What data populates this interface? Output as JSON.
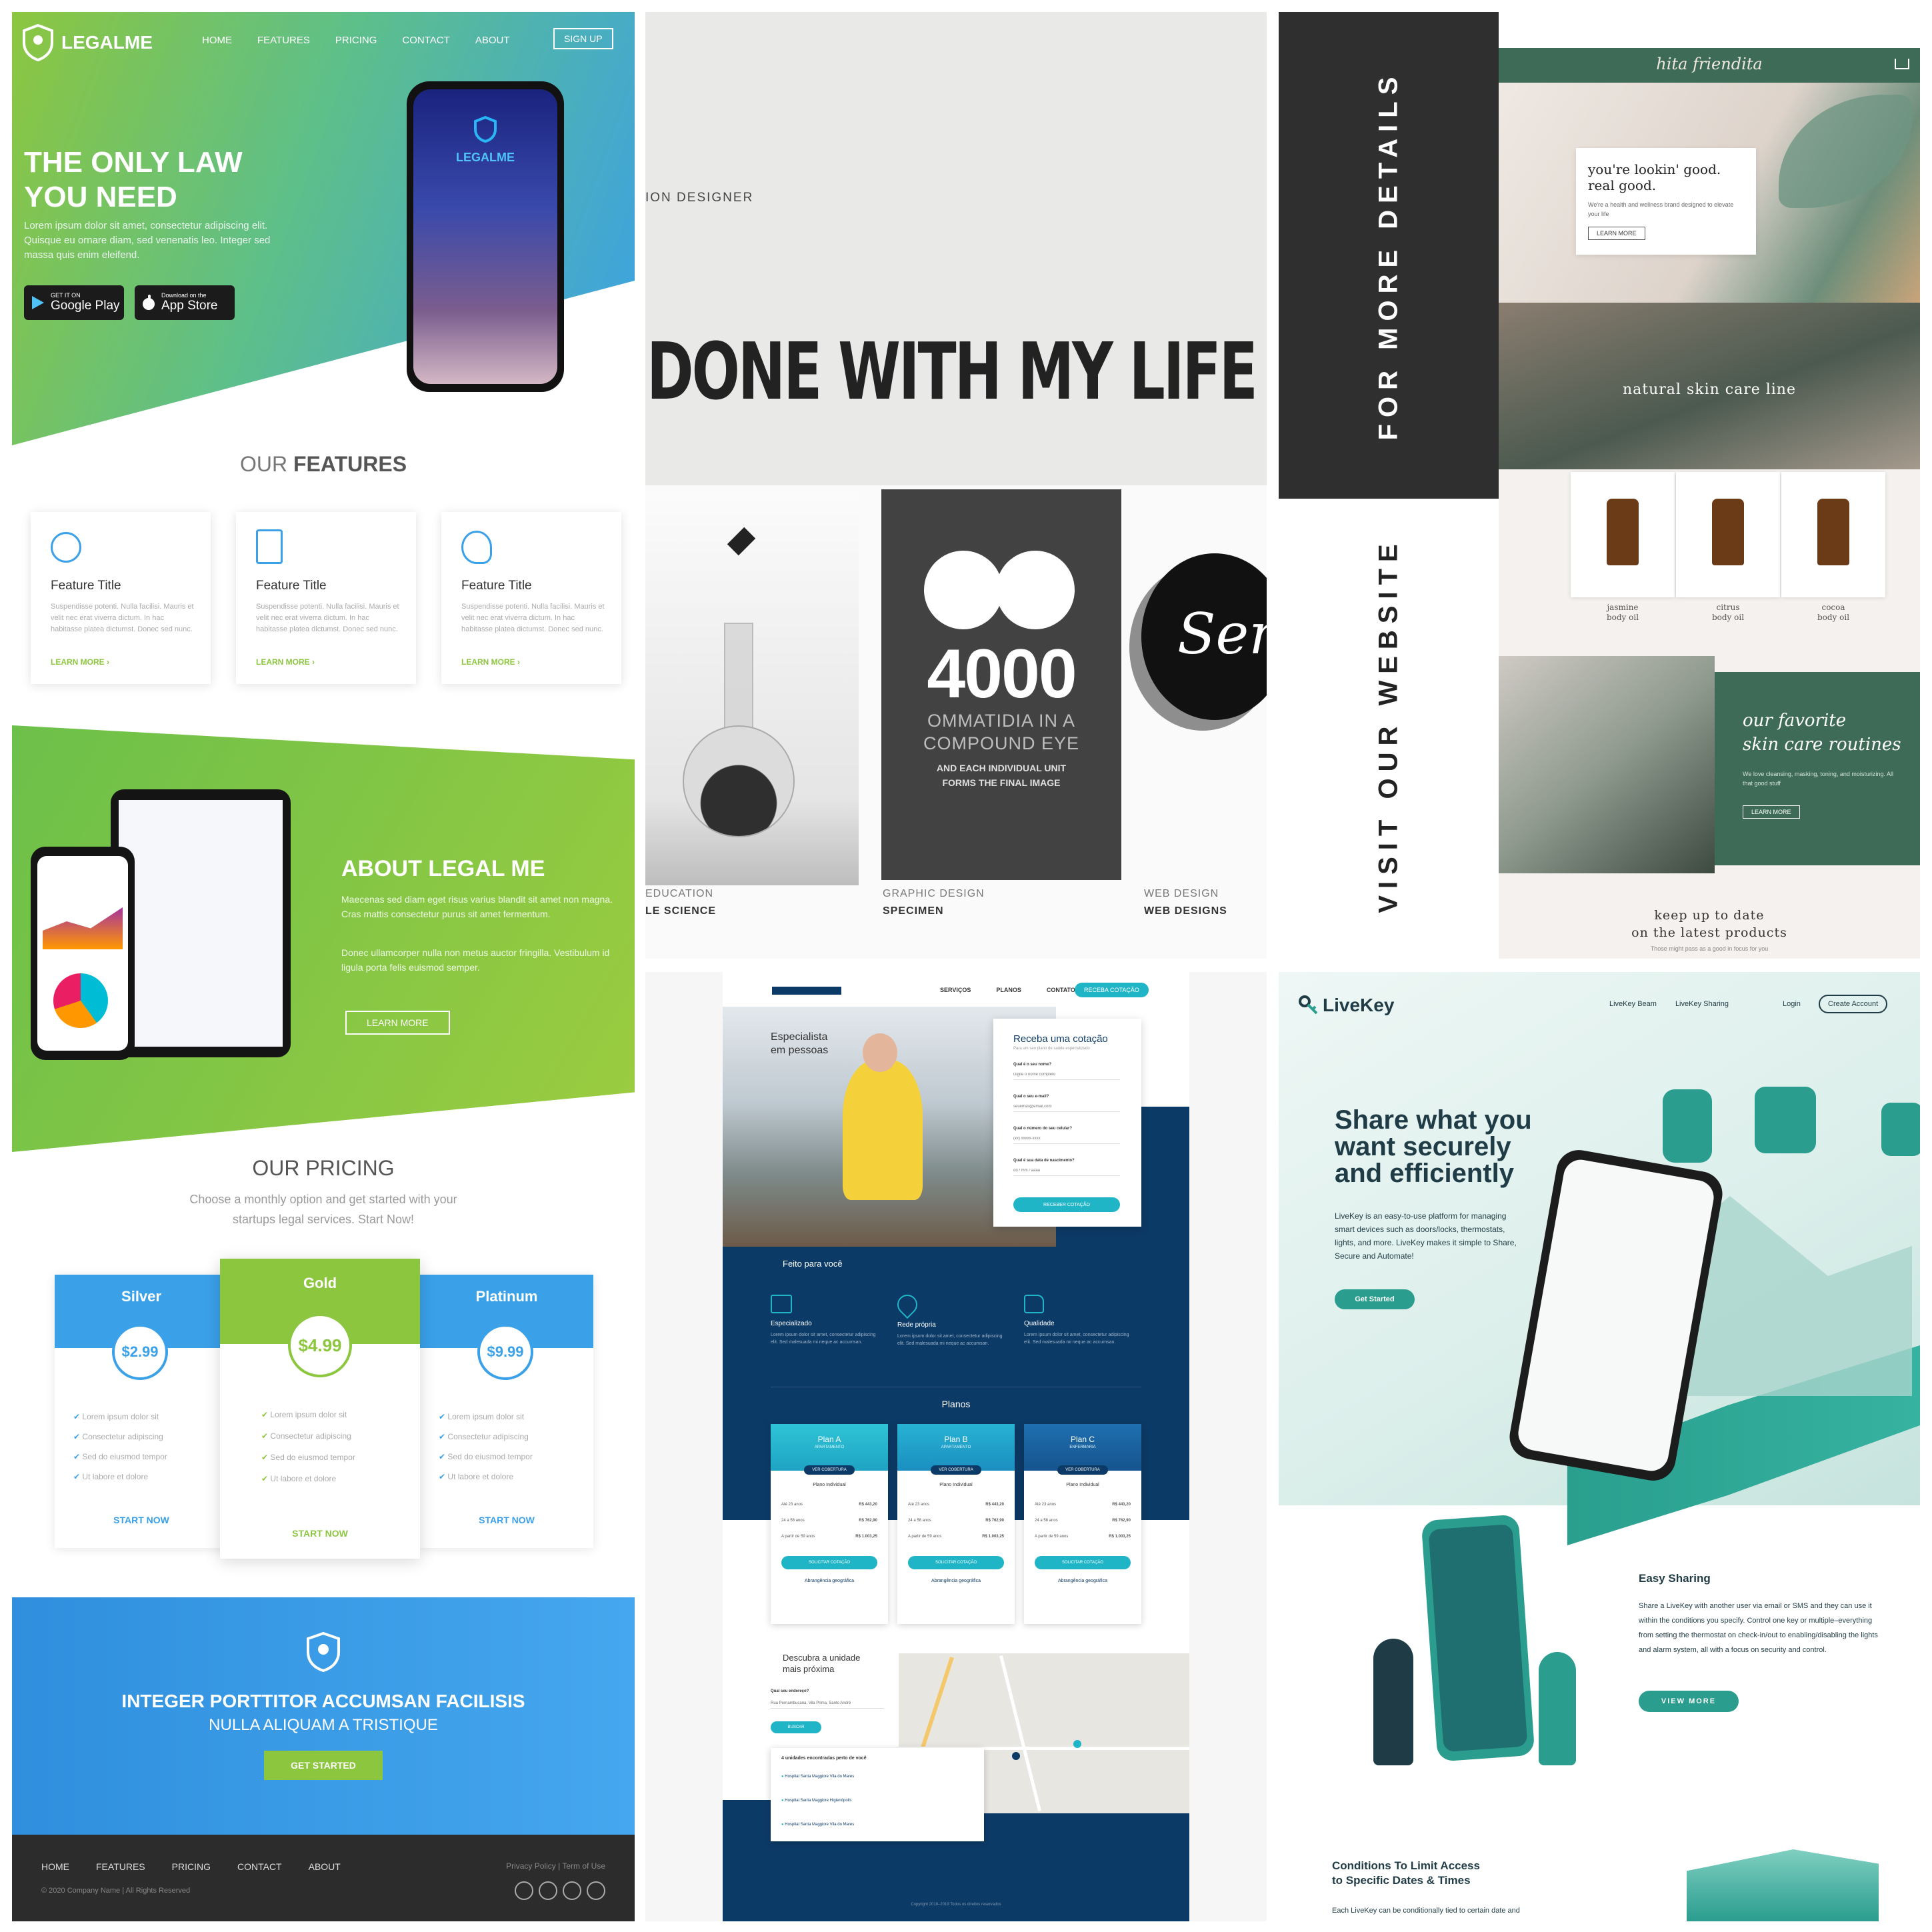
{
  "legalme": {
    "logo": "LEGALME",
    "nav": [
      "HOME",
      "FEATURES",
      "PRICING",
      "CONTACT",
      "ABOUT"
    ],
    "signup": "SIGN UP",
    "hero_title_1": "THE ONLY LAW",
    "hero_title_2": "YOU NEED",
    "hero_text": "Lorem ipsum dolor sit amet, consectetur adipiscing elit. Quisque eu ornare diam, sed venenatis leo. Integer sed massa quis enim eleifend.",
    "google_play_small": "GET IT ON",
    "google_play": "Google Play",
    "app_store_small": "Download on the",
    "app_store": "App Store",
    "phone_logo": "LEGALME",
    "features_heading_light": "OUR",
    "features_heading_bold": "FEATURES",
    "features": [
      {
        "title": "Feature Title",
        "text": "Suspendisse potenti. Nulla facilisi. Mauris et velit nec erat viverra dictum. In hac habitasse platea dictumst. Donec sed nunc.",
        "link": "LEARN MORE ›"
      },
      {
        "title": "Feature Title",
        "text": "Suspendisse potenti. Nulla facilisi. Mauris et velit nec erat viverra dictum. In hac habitasse platea dictumst. Donec sed nunc.",
        "link": "LEARN MORE ›"
      },
      {
        "title": "Feature Title",
        "text": "Suspendisse potenti. Nulla facilisi. Mauris et velit nec erat viverra dictum. In hac habitasse platea dictumst. Donec sed nunc.",
        "link": "LEARN MORE ›"
      }
    ],
    "about_title": "ABOUT LEGAL ME",
    "about_text_1": "Maecenas sed diam eget risus varius blandit sit amet non magna. Cras mattis consectetur purus sit amet fermentum.",
    "about_text_2": "Donec ullamcorper nulla non metus auctor fringilla. Vestibulum id ligula porta felis euismod semper.",
    "about_button": "LEARN MORE",
    "pricing_title": "OUR PRICING",
    "pricing_sub_1": "Choose a monthly option and get started with your",
    "pricing_sub_2": "startups legal services. Start Now!",
    "plans": [
      {
        "name": "Silver",
        "price": "$2.99",
        "items": [
          "Lorem ipsum dolor sit",
          "Consectetur adipiscing",
          "Sed do eiusmod tempor",
          "Ut labore et dolore"
        ],
        "cta": "START NOW"
      },
      {
        "name": "Gold",
        "price": "$4.99",
        "items": [
          "Lorem ipsum dolor sit",
          "Consectetur adipiscing",
          "Sed do eiusmod tempor",
          "Ut labore et dolore"
        ],
        "cta": "START NOW"
      },
      {
        "name": "Platinum",
        "price": "$9.99",
        "items": [
          "Lorem ipsum dolor sit",
          "Consectetur adipiscing",
          "Sed do eiusmod tempor",
          "Ut labore et dolore"
        ],
        "cta": "START NOW"
      }
    ],
    "cta_line_1": "INTEGER PORTTITOR ACCUMSAN FACILISIS",
    "cta_line_2": "NULLA ALIQUAM A TRISTIQUE",
    "cta_button": "GET STARTED",
    "footer_nav": [
      "HOME",
      "FEATURES",
      "PRICING",
      "CONTACT",
      "ABOUT"
    ],
    "footer_links": "Privacy Policy  |  Term of Use",
    "footer_copy": "© 2020 Company Name | All Rights Reserved",
    "colors": {
      "blue": "#3aa0e8",
      "green": "#8cc63f",
      "dark": "#2c2c2c"
    }
  },
  "designer": {
    "role": "ION DESIGNER",
    "headline": "DONE WITH MY LIFE SO",
    "card_number": "4000",
    "card_line_1": "OMMATIDIA IN A",
    "card_line_2": "COMPOUND EYE",
    "card_line_3": "AND EACH INDIVIDUAL UNIT",
    "card_line_4": "FORMS THE FINAL IMAGE",
    "sens": "Sens",
    "caption_1a": "EDUCATION",
    "caption_1b": "LE SCIENCE",
    "caption_2a": "GRAPHIC DESIGN",
    "caption_2b": "SPECIMEN",
    "caption_3a": "WEB DESIGN",
    "caption_3b": "WEB DESIGNS"
  },
  "skincare": {
    "vertical_1": "FOR MORE DETAILS",
    "vertical_2": "VISIT OUR WEBSITE",
    "brand": "hita friendita",
    "hero_title_1": "you're lookin' good.",
    "hero_title_2": "real good.",
    "hero_text": "We're a health and wellness brand designed to elevate your life",
    "hero_button": "LEARN MORE",
    "banner_title": "natural skin care line",
    "products": [
      {
        "name": "jasmine",
        "sub": "body oil"
      },
      {
        "name": "citrus",
        "sub": "body oil"
      },
      {
        "name": "cocoa",
        "sub": "body oil"
      }
    ],
    "fav_1": "our favorite",
    "fav_2": "skin care routines",
    "fav_text": "We love cleansing, masking, toning, and moisturizing. All that good stuff",
    "fav_button": "LEARN MORE",
    "keep_1": "keep up to date",
    "keep_2": "on the latest products",
    "keep_small": "Those might pass as a good in focus for you",
    "colors": {
      "green": "#3e6b57",
      "dark": "#2f2f2f"
    }
  },
  "insurance": {
    "nav": [
      "SERVIÇOS",
      "PLANOS",
      "CONTATO"
    ],
    "nav_button": "RECEBA COTAÇÃO",
    "hero_text_1": "Especialista",
    "hero_text_2": "em pessoas",
    "form_title": "Receba uma cotação",
    "form_sub": "Para um seu plano de saúde especializado",
    "form_fields": [
      {
        "label": "Qual é o seu nome?",
        "placeholder": "Digite o nome completo"
      },
      {
        "label": "Qual o seu e-mail?",
        "placeholder": "seuemail@email.com"
      },
      {
        "label": "Qual o número do seu celular?",
        "placeholder": "(xx) xxxxx-xxxx"
      },
      {
        "label": "Qual é sua data de nascimento?",
        "placeholder": "dd / mm / aaaa"
      }
    ],
    "form_button": "RECEBER COTAÇÃO",
    "made_for_you": "Feito para você",
    "benefits": [
      {
        "title": "Especializado",
        "text": "Lorem ipsum dolor sit amet, consectetur adipiscing elit. Sed malesuada mi neque ac accumsan."
      },
      {
        "title": "Rede própria",
        "text": "Lorem ipsum dolor sit amet, consectetur adipiscing elit. Sed malesuada mi neque ac accumsan."
      },
      {
        "title": "Qualidade",
        "text": "Lorem ipsum dolor sit amet, consectetur adipiscing elit. Sed malesuada mi neque ac accumsan."
      }
    ],
    "plans_title": "Planos",
    "plans": [
      {
        "name": "Plan A",
        "badge": "APARTAMENTO",
        "tag": "VER COBERTURA",
        "type": "Plano Individual",
        "rows": [
          [
            "Até 23 anos",
            "R$ 443,20"
          ],
          [
            "24 a 58 anos",
            "R$ 762,90"
          ],
          [
            "A partir de 59 anos",
            "R$ 1.003,25"
          ]
        ],
        "button": "SOLICITAR COTAÇÃO",
        "region": "Abrangência geográfica"
      },
      {
        "name": "Plan B",
        "badge": "APARTAMENTO",
        "tag": "VER COBERTURA",
        "type": "Plano Individual",
        "rows": [
          [
            "Até 23 anos",
            "R$ 443,20"
          ],
          [
            "24 a 58 anos",
            "R$ 762,90"
          ],
          [
            "A partir de 59 anos",
            "R$ 1.003,25"
          ]
        ],
        "button": "SOLICITAR COTAÇÃO",
        "region": "Abrangência geográfica"
      },
      {
        "name": "Plan C",
        "badge": "ENFERMARIA",
        "tag": "VER COBERTURA",
        "type": "Plano Individual",
        "rows": [
          [
            "Até 23 anos",
            "R$ 443,20"
          ],
          [
            "24 a 58 anos",
            "R$ 762,90"
          ],
          [
            "A partir de 59 anos",
            "R$ 1.003,25"
          ]
        ],
        "button": "SOLICITAR COTAÇÃO",
        "region": "Abrangência geográfica"
      }
    ],
    "map_title_1": "Descubra a unidade",
    "map_title_2": "mais próxima",
    "map_label": "Qual seu endereço?",
    "map_input": "Rua Pernambucana, Vila Prima, Santo André",
    "map_button": "BUSCAR",
    "results_title": "4 unidades encontradas perto de você",
    "results": [
      "Hospital Santa Maggiore Vila do Mares",
      "Hospital Santa Maggiore Higienópolis",
      "Hospital Santa Maggiore Vila do Mares"
    ],
    "footer": "Copyright 2018–2019 Todos os direitos reservados",
    "colors": {
      "navy": "#0c3a66",
      "teal": "#1fb5c7"
    }
  },
  "livekey": {
    "logo": "LiveKey",
    "nav": [
      "LiveKey Beam",
      "LiveKey Sharing"
    ],
    "login": "Login",
    "create": "Create Account",
    "hero_1": "Share what you",
    "hero_2": "want securely",
    "hero_3": "and efficiently",
    "hero_text": "LiveKey is an easy-to-use platform for managing smart devices such as doors/locks, thermostats, lights, and more. LiveKey makes it simple to Share, Secure and Automate!",
    "hero_button": "Get Started",
    "sharing_title": "Easy Sharing",
    "sharing_text": "Share a LiveKey with another user via email or SMS and they can use it within the conditions you specify. Control one key or multiple–everything from setting the thermostat on check-in/out to enabling/disabling the lights and alarm system, all with a focus on security and control.",
    "sharing_button": "VIEW MORE",
    "cond_title_1": "Conditions To Limit Access",
    "cond_title_2": "to Specific Dates & Times",
    "cond_text": "Each LiveKey can be conditionally tied to certain date and",
    "colors": {
      "teal": "#2a9d8f",
      "dark": "#1f3b45"
    }
  }
}
